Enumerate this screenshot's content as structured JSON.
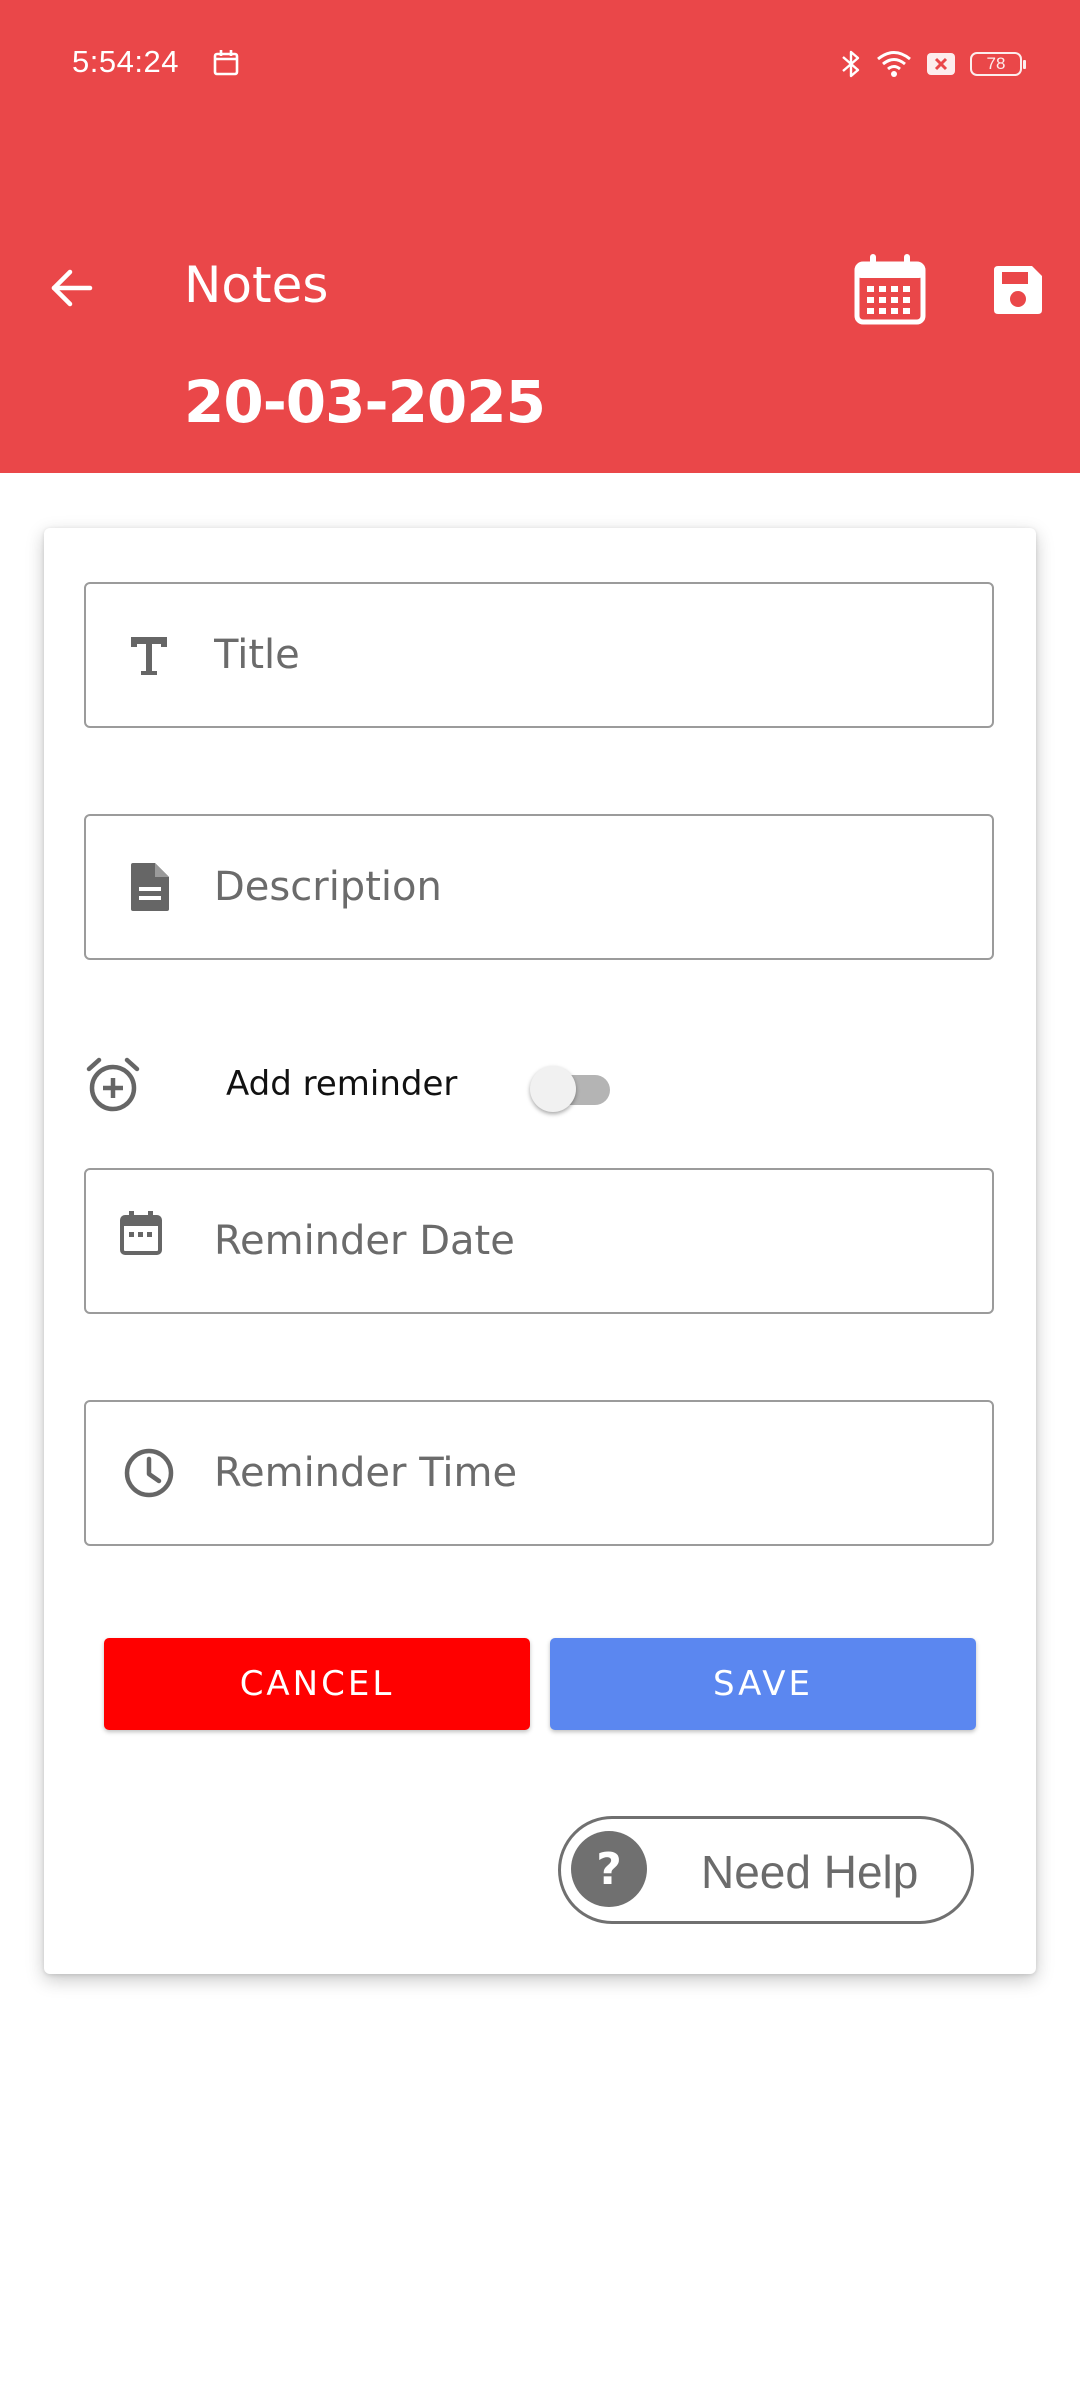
{
  "status_bar": {
    "time": "5:54:24",
    "battery_level": "78",
    "icons": [
      "calendar-icon",
      "bluetooth-icon",
      "wifi-icon",
      "sim-error-icon",
      "battery-icon"
    ]
  },
  "app_bar": {
    "title": "Notes",
    "date": "20-03-2025",
    "color": "#ea4749",
    "icons": [
      "back-arrow-icon",
      "calendar-icon",
      "save-icon"
    ]
  },
  "form": {
    "title_placeholder": "Title",
    "title_value": "",
    "description_placeholder": "Description",
    "description_value": "",
    "reminder_label": "Add reminder",
    "reminder_enabled": false,
    "reminder_date_placeholder": "Reminder Date",
    "reminder_date_value": "",
    "reminder_time_placeholder": "Reminder Time",
    "reminder_time_value": ""
  },
  "actions": {
    "cancel_label": "CANCEL",
    "save_label": "SAVE",
    "cancel_color": "#ff0000",
    "save_color": "#5b87f0"
  },
  "help": {
    "label": "Need Help",
    "icon_glyph": "?"
  }
}
